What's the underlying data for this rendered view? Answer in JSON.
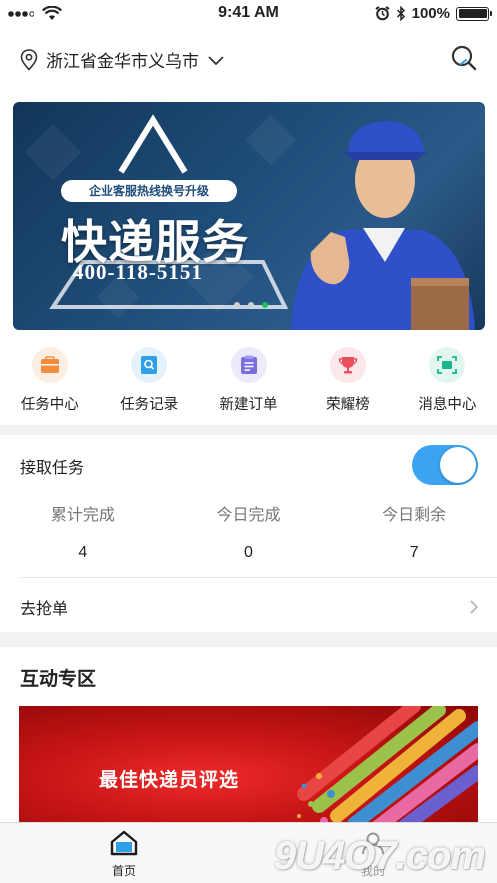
{
  "status_bar": {
    "time": "9:41 AM",
    "battery": "100%"
  },
  "header": {
    "location": "浙江省金华市义乌市",
    "location_icon": "location-pin-icon",
    "search_icon": "search-icon"
  },
  "banner": {
    "tagline": "企业客服热线换号升级",
    "title": "快递服务",
    "phone": "400-118-5151",
    "slides": 3,
    "active_slide": 3
  },
  "quick_nav": [
    {
      "label": "任务中心",
      "icon": "task-center-icon",
      "color": "#f28c3a",
      "bg": "#fdeee3"
    },
    {
      "label": "任务记录",
      "icon": "task-record-icon",
      "color": "#2e9fe8",
      "bg": "#e4f2fc"
    },
    {
      "label": "新建订单",
      "icon": "new-order-icon",
      "color": "#7a6fe0",
      "bg": "#ecebfb"
    },
    {
      "label": "荣耀榜",
      "icon": "trophy-icon",
      "color": "#e8505b",
      "bg": "#fce8ea"
    },
    {
      "label": "消息中心",
      "icon": "message-center-icon",
      "color": "#19b58f",
      "bg": "#e2f6f0"
    }
  ],
  "task": {
    "title": "接取任务",
    "toggle_on": true,
    "stats": [
      {
        "label": "累计完成",
        "value": "4"
      },
      {
        "label": "今日完成",
        "value": "0"
      },
      {
        "label": "今日剩余",
        "value": "7"
      }
    ],
    "grab_label": "去抢单"
  },
  "interact": {
    "title": "互动专区",
    "promo_text": "最佳快递员评选"
  },
  "tabbar": {
    "tabs": [
      {
        "label": "首页",
        "icon": "home-icon"
      },
      {
        "label": "我的",
        "icon": "profile-icon"
      }
    ],
    "watermark": "9U4O7.com"
  },
  "colors": {
    "accent_blue": "#3aa3f2",
    "active_dot": "#17c15b",
    "promo_red": "#c51414"
  }
}
